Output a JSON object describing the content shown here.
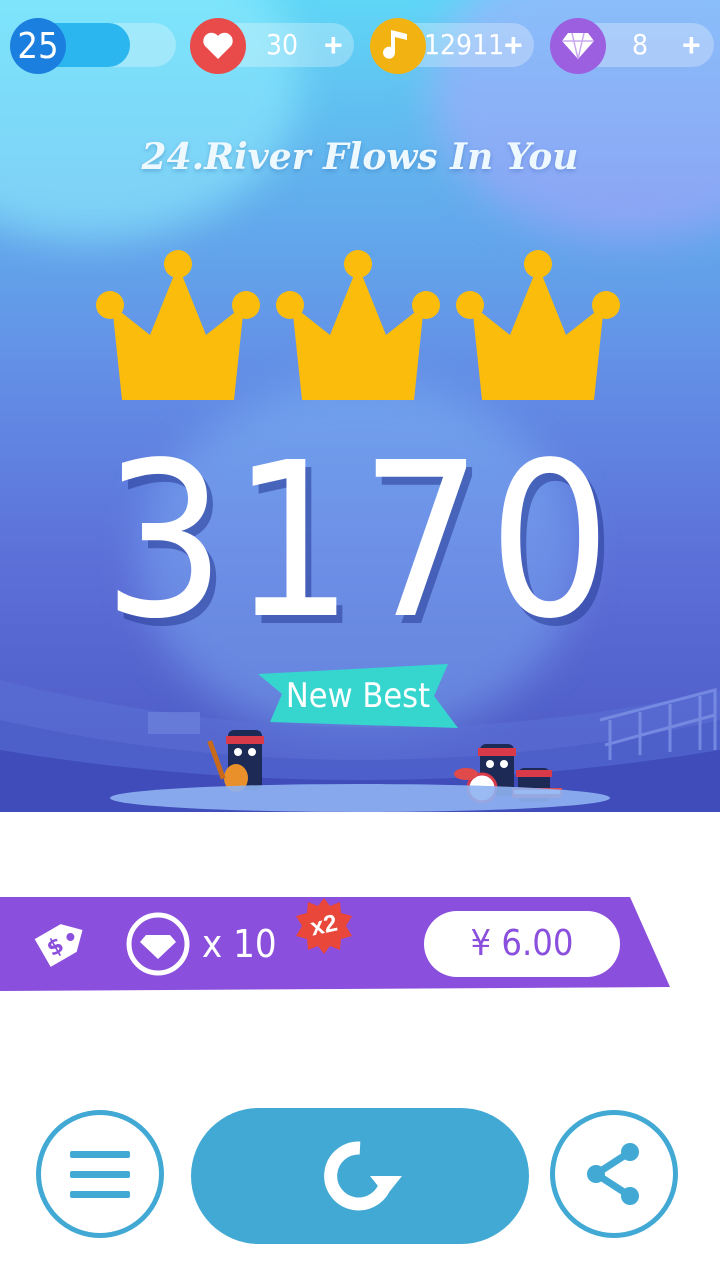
{
  "status_bar": {
    "level": "25",
    "level_progress": 0.55,
    "lives": "30",
    "notes": "12911",
    "diamonds": "8",
    "plus": "+"
  },
  "song": {
    "title": "24.River Flows In You"
  },
  "result": {
    "crowns_earned": 3,
    "crowns_total": 3,
    "score": "3170",
    "new_best_label": "New Best"
  },
  "offer": {
    "quantity": "x 10",
    "multiplier": "x2",
    "price": "¥ 6.00"
  },
  "colors": {
    "level_blue": "#1b7fe0",
    "heart_red": "#e94a4a",
    "note_gold": "#f2b211",
    "diamond_purple": "#9c5fe0",
    "crown_gold": "#fcbc0b",
    "new_best_teal": "#36d6cf",
    "offer_purple": "#8a4fdc",
    "button_blue": "#41a9d4"
  },
  "icons": {
    "level": "level-badge",
    "lives": "heart-icon",
    "notes": "music-note-icon",
    "diamonds": "diamond-icon",
    "offer_tag": "price-tag-icon",
    "menu": "menu-icon",
    "replay": "replay-icon",
    "share": "share-icon"
  }
}
